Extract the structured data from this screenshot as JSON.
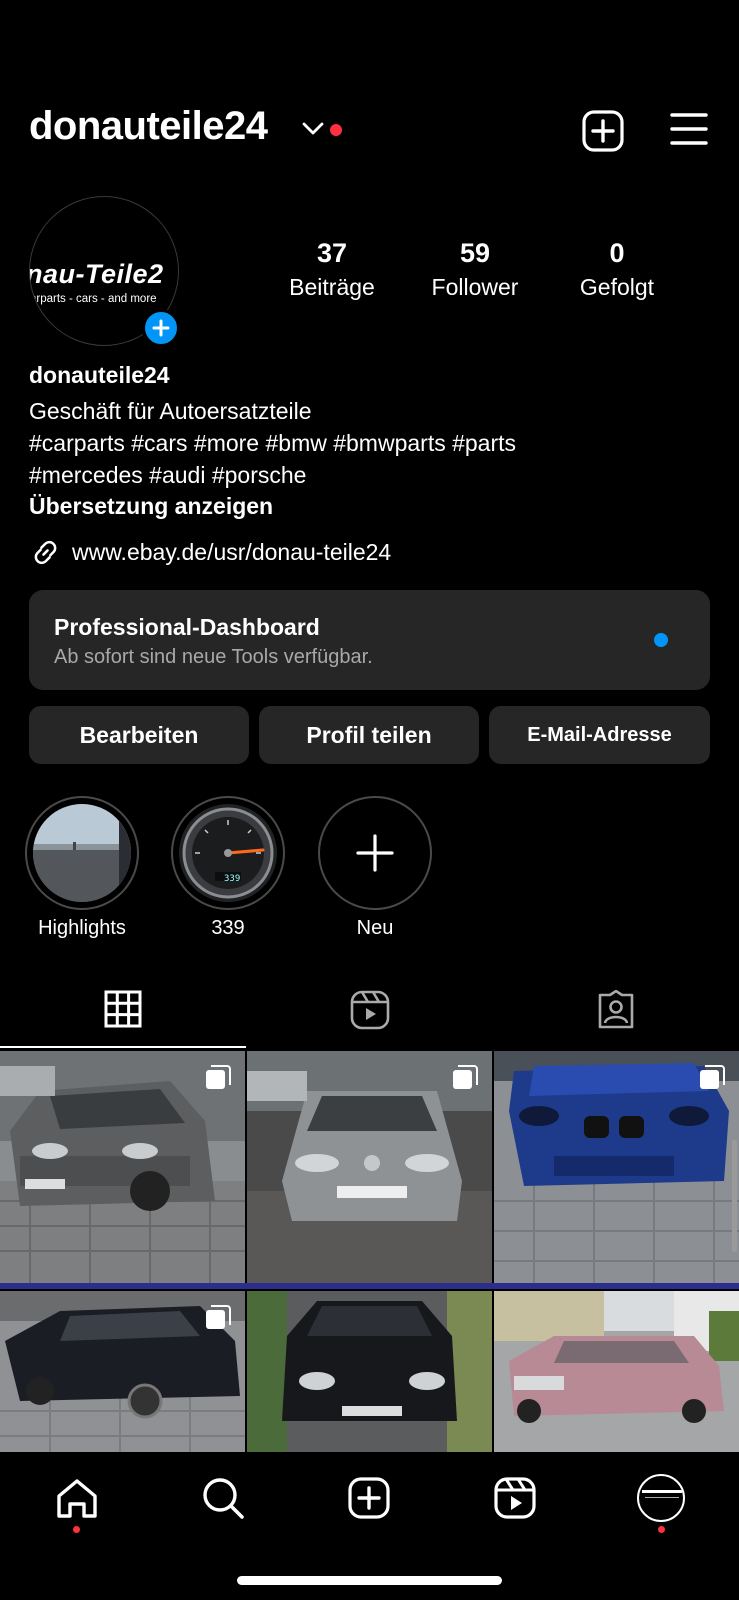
{
  "header": {
    "username": "donauteile24"
  },
  "avatar": {
    "logo_text": "nau-Teile2",
    "logo_sub": "arparts - cars - and more"
  },
  "stats": [
    {
      "value": "37",
      "label": "Beiträge"
    },
    {
      "value": "59",
      "label": "Follower"
    },
    {
      "value": "0",
      "label": "Gefolgt"
    }
  ],
  "bio": {
    "name": "donauteile24",
    "lines": [
      "Geschäft für Autoersatzteile",
      "#carparts #cars #more #bmw #bmwparts #parts",
      "#mercedes #audi  #porsche"
    ],
    "translate": "Übersetzung anzeigen",
    "link": "www.ebay.de/usr/donau-teile24"
  },
  "dashboard": {
    "title": "Professional-Dashboard",
    "subtitle": "Ab sofort sind neue Tools verfügbar."
  },
  "buttons": {
    "edit": "Bearbeiten",
    "share": "Profil teilen",
    "email": "E-Mail-Adresse"
  },
  "highlights": [
    {
      "label": "Highlights"
    },
    {
      "label": "339"
    },
    {
      "label": "Neu"
    }
  ],
  "gauge_readout": "339",
  "colors": {
    "accent": "#0095f6",
    "notification": "#ff3040",
    "card": "#262626"
  }
}
